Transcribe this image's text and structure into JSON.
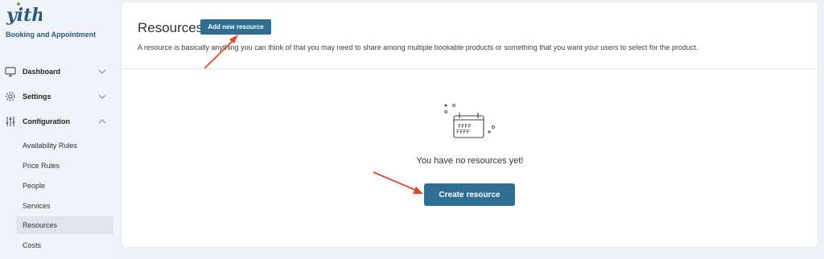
{
  "brand": {
    "logo_text": "yith",
    "plugin_name": "Booking and Appointment",
    "logo_color": "#2a5a7a",
    "logo_accent": "#6fb24a"
  },
  "sidebar": {
    "items": [
      {
        "label": "Dashboard",
        "icon": "monitor-icon",
        "expanded": false
      },
      {
        "label": "Settings",
        "icon": "gear-icon",
        "expanded": false
      },
      {
        "label": "Configuration",
        "icon": "sliders-icon",
        "expanded": true
      }
    ],
    "sub_items": [
      {
        "label": "Availability Rules",
        "active": false
      },
      {
        "label": "Price Rules",
        "active": false
      },
      {
        "label": "People",
        "active": false
      },
      {
        "label": "Services",
        "active": false
      },
      {
        "label": "Resources",
        "active": true
      },
      {
        "label": "Costs",
        "active": false
      }
    ]
  },
  "main": {
    "title": "Resources",
    "add_button": "Add new resource",
    "description": "A resource is basically anything you can think of that you may need to share among multiple bookable products or something that you want your users to select for the product.",
    "empty_icon": "calendar-icon",
    "empty_message": "You have no resources yet!",
    "create_button": "Create resource"
  },
  "colors": {
    "primary_button": "#2f6e93",
    "annotation_arrow": "#e2462a",
    "sidebar_bg": "#f0f3f7",
    "active_item_bg": "#e1e5ea"
  }
}
